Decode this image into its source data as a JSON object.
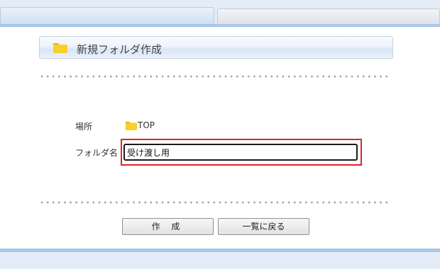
{
  "title": {
    "text": "新規フォルダ作成",
    "icon": "folder-icon"
  },
  "form": {
    "location_label": "場所",
    "location_value": "TOP",
    "folder_name_label": "フォルダ名",
    "folder_name_value": "受け渡し用"
  },
  "buttons": {
    "create_label": "作 成",
    "back_label": "一覧に戻る"
  },
  "colors": {
    "highlight": "#e0242b",
    "accent": "#a9c6e6",
    "folder": "#f5c518"
  }
}
